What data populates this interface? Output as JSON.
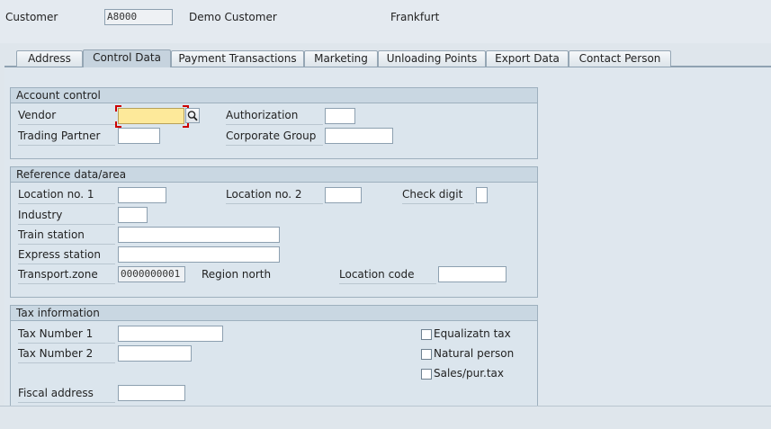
{
  "header": {
    "customer_label": "Customer",
    "customer_value": "A8000",
    "customer_name": "Demo Customer",
    "city": "Frankfurt"
  },
  "tabs": [
    {
      "label": "Address",
      "active": false
    },
    {
      "label": "Control Data",
      "active": true
    },
    {
      "label": "Payment Transactions",
      "active": false
    },
    {
      "label": "Marketing",
      "active": false
    },
    {
      "label": "Unloading Points",
      "active": false
    },
    {
      "label": "Export Data",
      "active": false
    },
    {
      "label": "Contact Person",
      "active": false
    }
  ],
  "account_control": {
    "title": "Account control",
    "vendor_label": "Vendor",
    "vendor_value": "",
    "authorization_label": "Authorization",
    "authorization_value": "",
    "trading_partner_label": "Trading Partner",
    "trading_partner_value": "",
    "corporate_group_label": "Corporate Group",
    "corporate_group_value": ""
  },
  "reference_data": {
    "title": "Reference data/area",
    "location1_label": "Location no. 1",
    "location1_value": "",
    "location2_label": "Location no. 2",
    "location2_value": "",
    "check_digit_label": "Check digit",
    "check_digit_value": "",
    "industry_label": "Industry",
    "industry_value": "",
    "train_station_label": "Train station",
    "train_station_value": "",
    "express_station_label": "Express station",
    "express_station_value": "",
    "transport_zone_label": "Transport.zone",
    "transport_zone_value": "0000000001",
    "transport_zone_desc": "Region north",
    "location_code_label": "Location code",
    "location_code_value": ""
  },
  "tax_information": {
    "title": "Tax information",
    "tax_number1_label": "Tax Number 1",
    "tax_number1_value": "",
    "tax_number2_label": "Tax Number 2",
    "tax_number2_value": "",
    "fiscal_address_label": "Fiscal address",
    "fiscal_address_value": "",
    "equalization_tax_label": "Equalizatn tax",
    "equalization_tax_checked": false,
    "natural_person_label": "Natural person",
    "natural_person_checked": false,
    "sales_pur_tax_label": "Sales/pur.tax",
    "sales_pur_tax_checked": false
  },
  "icons": {
    "vendor_search": "search-icon"
  }
}
